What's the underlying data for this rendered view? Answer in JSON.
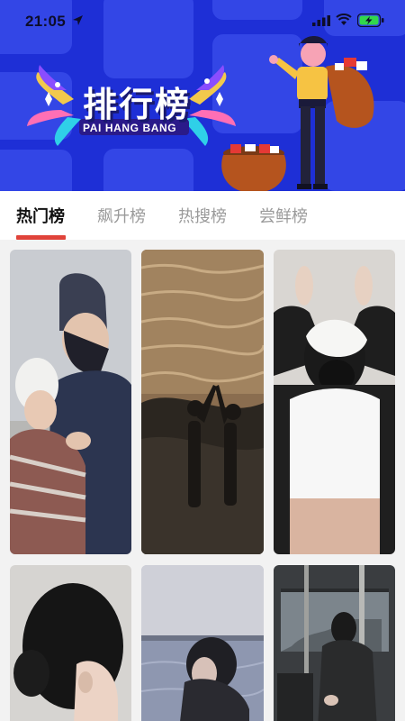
{
  "status_bar": {
    "time": "21:05",
    "icons": [
      "location-arrow-icon",
      "signal-icon",
      "wifi-icon",
      "battery-charging-icon"
    ]
  },
  "banner": {
    "title": "排行榜",
    "subtitle": "PAI HANG BANG",
    "background_color": "#1e2fd6",
    "tile_color": "#3346e6"
  },
  "tabs": [
    {
      "label": "热门榜",
      "active": true
    },
    {
      "label": "飙升榜",
      "active": false
    },
    {
      "label": "热搜榜",
      "active": false
    },
    {
      "label": "尝鲜榜",
      "active": false
    }
  ],
  "accent_color": "#e0433a",
  "photos": [
    {
      "subject": "couple-in-winter-hats"
    },
    {
      "subject": "couple-dancing-on-beach"
    },
    {
      "subject": "woman-with-white-hair-scrunchie"
    },
    {
      "subject": "woman-hair-bun-side-view"
    },
    {
      "subject": "woman-at-seaside"
    },
    {
      "subject": "person-on-bus"
    }
  ]
}
